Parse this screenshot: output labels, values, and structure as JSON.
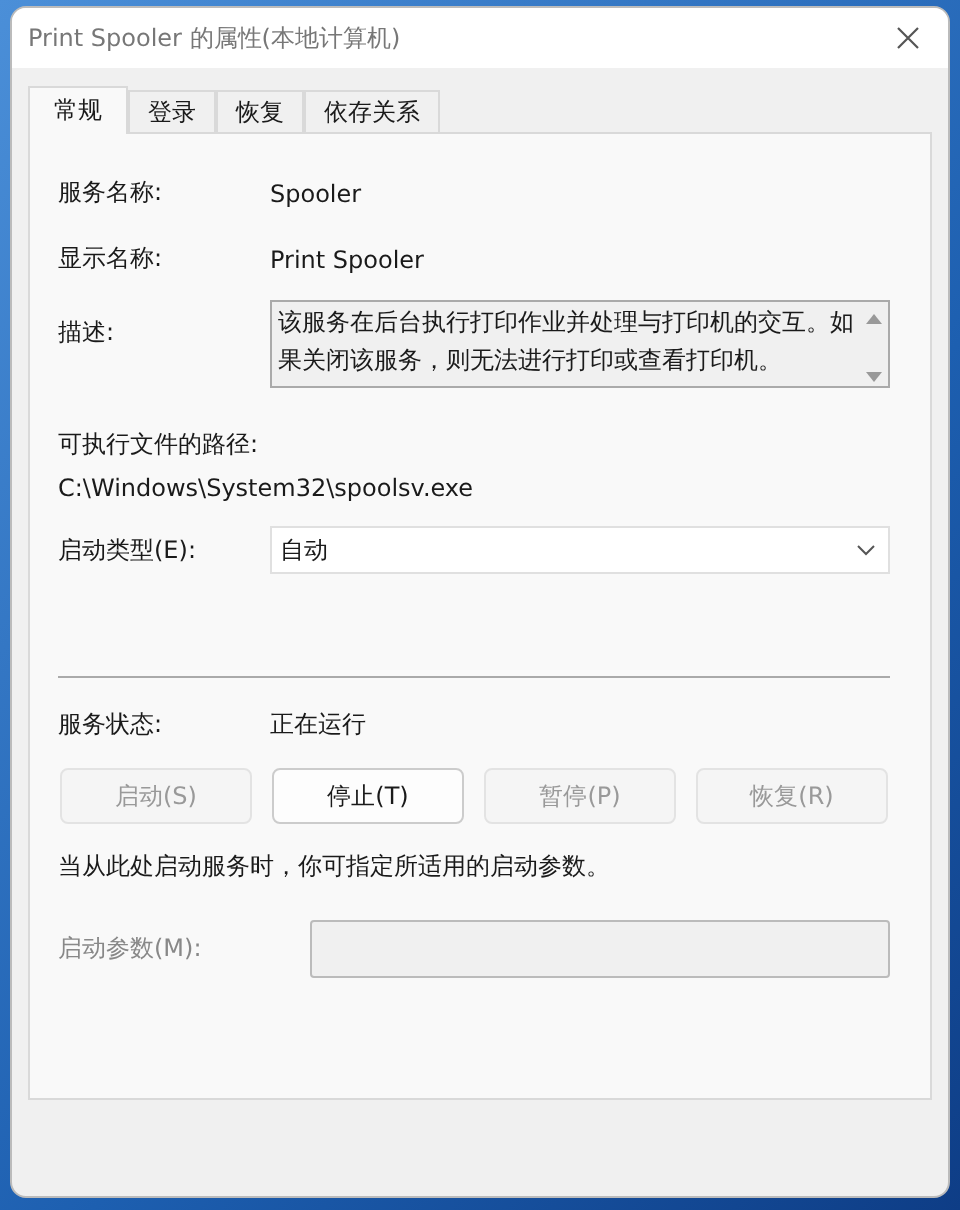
{
  "window": {
    "title": "Print Spooler 的属性(本地计算机)"
  },
  "tabs": [
    {
      "label": "常规",
      "selected": true
    },
    {
      "label": "登录",
      "selected": false
    },
    {
      "label": "恢复",
      "selected": false
    },
    {
      "label": "依存关系",
      "selected": false
    }
  ],
  "fields": {
    "service_name_label": "服务名称:",
    "service_name": "Spooler",
    "display_name_label": "显示名称:",
    "display_name": "Print Spooler",
    "description_label": "描述:",
    "description": "该服务在后台执行打印作业并处理与打印机的交互。如果关闭该服务，则无法进行打印或查看打印机。",
    "path_label": "可执行文件的路径:",
    "path": "C:\\Windows\\System32\\spoolsv.exe",
    "startup_type_label": "启动类型(E):",
    "startup_type": "自动"
  },
  "status": {
    "label": "服务状态:",
    "value": "正在运行"
  },
  "buttons": [
    {
      "label": "启动(S)",
      "disabled": true
    },
    {
      "label": "停止(T)",
      "disabled": false
    },
    {
      "label": "暂停(P)",
      "disabled": true
    },
    {
      "label": "恢复(R)",
      "disabled": true
    }
  ],
  "hint": "当从此处启动服务时，你可指定所适用的启动参数。",
  "parameters": {
    "label": "启动参数(M):",
    "disabled": true
  }
}
